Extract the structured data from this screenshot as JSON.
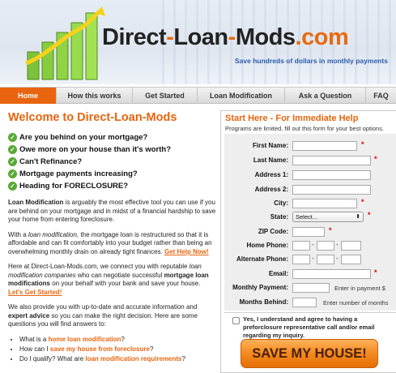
{
  "header": {
    "brand_part1": "Direct",
    "brand_dash1": "-",
    "brand_part2": "Loan",
    "brand_dash2": "-",
    "brand_part3": "Mods",
    "brand_suffix": ".com",
    "tagline": "Save hundreds of dollars in monthly payments"
  },
  "nav": {
    "items": [
      "Home",
      "How this works",
      "Get Started",
      "Loan Modification",
      "Ask a Question",
      "FAQ"
    ]
  },
  "main": {
    "title": "Welcome to Direct-Loan-Mods",
    "questions": [
      "Are you behind on your mortgage?",
      "Owe more on your house than it's worth?",
      "Can't Refinance?",
      "Mortgage payments increasing?",
      "Heading for FORECLOSURE?"
    ],
    "p1_bold": "Loan Modification",
    "p1_text": " is arguably the most effective tool you can use if you are behind on your mortgage and in midst of a financial hardship to save your home from entering foreclosure.",
    "p2_a": "With a ",
    "p2_italic": "loan modification,",
    "p2_b": " the mortgage loan is restructured so that it is affordable and can fit comfortably into your budget rather than being an overwhelming monthly drain on already tight finances. ",
    "p2_link": "Get Help Now!",
    "p3_a": "Here at Direct-Loan-Mods.com, we connect you with reputable ",
    "p3_italic": "loan modification companies",
    "p3_b": " who can negotiate successful ",
    "p3_bold": "mortgage loan modifications",
    "p3_c": " on your behalf with your bank and save your house. ",
    "p3_link": "Let's Get Started!",
    "p4_a": "We also provide you with up-to-date and accurate information and ",
    "p4_bold": "expert advice",
    "p4_b": " so you can make the right decision. Here are some questions you will find answers to:",
    "bullets": [
      {
        "pre": "What is a ",
        "link": "home loan modification",
        "post": "?"
      },
      {
        "pre": "How can I ",
        "link": "save my house from foreclosure",
        "post": "?"
      },
      {
        "pre": "Do I qualify? What are ",
        "link": "loan modification requirements",
        "post": "?"
      }
    ]
  },
  "form": {
    "title": "Start Here - For Immediate Help",
    "subtitle": "Programs are limited, fill out this form for your best options.",
    "labels": {
      "first_name": "First Name:",
      "last_name": "Last Name:",
      "address1": "Address 1:",
      "address2": "Address 2:",
      "city": "City:",
      "state": "State:",
      "zip": "ZIP Code:",
      "home_phone": "Home Phone:",
      "alt_phone": "Alternate Phone:",
      "email": "Email:",
      "monthly_payment": "Monthly Payment:",
      "months_behind": "Months Behind:"
    },
    "required_mark": "*",
    "phone_dash": "-",
    "state_value": "Select...",
    "state_arrow": "⬍",
    "monthly_hint": "Enter in payment $",
    "months_hint": "Enter number of months",
    "consent": "Yes, I understand and agree to having a preforclosure representative call and/or email regarding my inquiry.",
    "submit_label": "SAVE MY HOUSE!"
  },
  "colors": {
    "accent": "#e8640e",
    "nav_active": "#e8640e",
    "tagline": "#2a5db0",
    "check": "#58a936"
  },
  "icons": [
    "bar-chart-logo-icon",
    "check-icon",
    "select-arrow-icon"
  ]
}
